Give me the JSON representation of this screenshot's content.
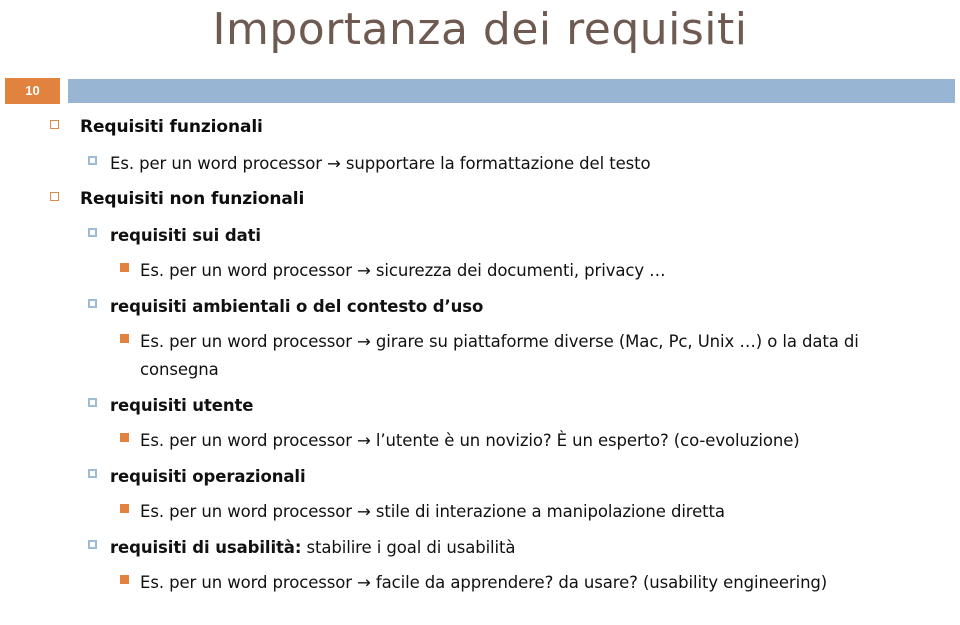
{
  "slide": {
    "title": "Importanza dei requisiti",
    "number": "10",
    "title_color": "#6e5a51",
    "accent_orange": "#e2823f",
    "accent_blue": "#98b5d4",
    "bullet_l1_color": "#dd8a4e",
    "bullet_l2_color": "#9dbcd8",
    "bullet_l3_color": "#e2823f"
  },
  "outline": [
    {
      "level": 1,
      "bullet": "hollow-orange-square-bullet",
      "text": "Requisiti funzionali",
      "bold": true
    },
    {
      "level": 2,
      "bullet": "blue-square-bullet",
      "text": "Es. per un word processor → supportare la formattazione del testo",
      "bold": false
    },
    {
      "level": 1,
      "bullet": "hollow-orange-square-bullet",
      "text": "Requisiti non funzionali",
      "bold": true
    },
    {
      "level": 2,
      "bullet": "blue-square-bullet",
      "text": "requisiti sui dati",
      "bold": true
    },
    {
      "level": 3,
      "bullet": "solid-orange-square-bullet",
      "text": "Es. per un word processor → sicurezza dei documenti, privacy …",
      "bold": false
    },
    {
      "level": 2,
      "bullet": "blue-square-bullet",
      "text": "requisiti ambientali o del contesto d’uso",
      "bold": true
    },
    {
      "level": 3,
      "bullet": "solid-orange-square-bullet",
      "text": "Es. per un word processor → girare su piattaforme diverse (Mac, Pc, Unix …) o la data di consegna",
      "bold": false
    },
    {
      "level": 2,
      "bullet": "blue-square-bullet",
      "text": "requisiti utente",
      "bold": true
    },
    {
      "level": 3,
      "bullet": "solid-orange-square-bullet",
      "text": "Es. per un word processor → l’utente è un novizio? È un esperto? (co-evoluzione)",
      "bold": false
    },
    {
      "level": 2,
      "bullet": "blue-square-bullet",
      "text": "requisiti operazionali",
      "bold": true
    },
    {
      "level": 3,
      "bullet": "solid-orange-square-bullet",
      "text": "Es. per un word processor → stile di interazione a manipolazione diretta",
      "bold": false
    },
    {
      "level": 2,
      "bullet": "blue-square-bullet",
      "text_bold_part": "requisiti di usabilità:",
      "text_normal_part": " stabilire i goal di usabilità",
      "text": "requisiti di usabilità: stabilire i goal di usabilità",
      "bold": "mixed"
    },
    {
      "level": 3,
      "bullet": "solid-orange-square-bullet",
      "text": "Es. per un word processor → facile da apprendere? da usare? (usability engineering)",
      "bold": false
    }
  ]
}
